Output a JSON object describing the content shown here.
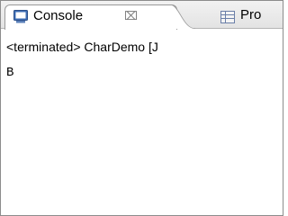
{
  "tabs": {
    "console": {
      "label": "Console",
      "close_glyph": "⌧",
      "icon": "console-icon"
    },
    "next": {
      "label": "Pro",
      "icon": "properties-icon"
    }
  },
  "status_line": "<terminated> CharDemo [J",
  "console_output": "B"
}
